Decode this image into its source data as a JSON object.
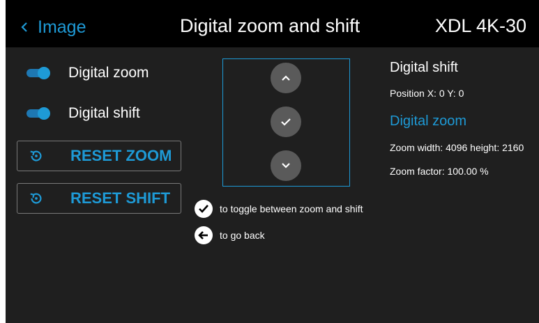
{
  "header": {
    "back_label": "Image",
    "title": "Digital zoom and shift",
    "model": "XDL 4K-30"
  },
  "toggles": [
    {
      "label": "Digital zoom",
      "on": true
    },
    {
      "label": "Digital shift",
      "on": true
    }
  ],
  "buttons": {
    "reset_zoom": "RESET ZOOM",
    "reset_shift": "RESET SHIFT"
  },
  "dpad": {
    "icons": [
      "chevron-up-icon",
      "checkmark-icon",
      "chevron-down-icon"
    ]
  },
  "hints": {
    "toggle": "to toggle between zoom and shift",
    "back": "to go back"
  },
  "info": {
    "shift_title": "Digital shift",
    "position": "Position X: 0 Y: 0",
    "zoom_title": "Digital zoom",
    "zoom_size": "Zoom width: 4096 height: 2160",
    "zoom_factor": "Zoom factor: 100.00 %"
  },
  "colors": {
    "accent": "#1e9ad6",
    "background": "#1f1f1f",
    "header": "#000000",
    "button_circle": "#5a5a5a"
  }
}
